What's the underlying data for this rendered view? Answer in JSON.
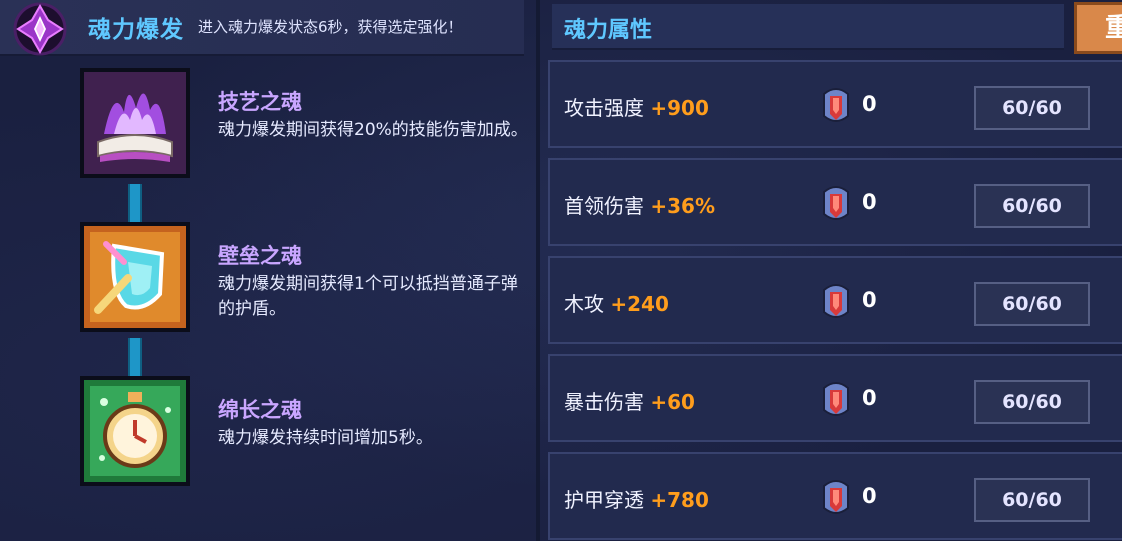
{
  "burst": {
    "title": "魂力爆发",
    "desc": "进入魂力爆发状态6秒，获得选定强化！"
  },
  "souls": [
    {
      "name": "技艺之魂",
      "desc": "魂力爆发期间获得20%的技能伤害加成。",
      "icon": "purple-flame-book-icon"
    },
    {
      "name": "壁垒之魂",
      "desc": "魂力爆发期间获得1个可以抵挡普通子弹的护盾。",
      "icon": "shield-icon"
    },
    {
      "name": "绵长之魂",
      "desc": "魂力爆发持续时间增加5秒。",
      "icon": "stopwatch-icon"
    }
  ],
  "attributes": {
    "title": "魂力属性",
    "reset_label": "重",
    "rows": [
      {
        "name": "攻击强度",
        "bonus": "+900",
        "count": "0",
        "capacity": "60/60"
      },
      {
        "name": "首领伤害",
        "bonus": "+36%",
        "count": "0",
        "capacity": "60/60"
      },
      {
        "name": "木攻",
        "bonus": "+240",
        "count": "0",
        "capacity": "60/60"
      },
      {
        "name": "暴击伤害",
        "bonus": "+60",
        "count": "0",
        "capacity": "60/60"
      },
      {
        "name": "护甲穿透",
        "bonus": "+780",
        "count": "0",
        "capacity": "60/60"
      }
    ]
  },
  "colors": {
    "accent_title": "#5fc8ff",
    "soul_name": "#c9a6ff",
    "bonus": "#ff9d1c",
    "reset_button": "#d9884a"
  }
}
